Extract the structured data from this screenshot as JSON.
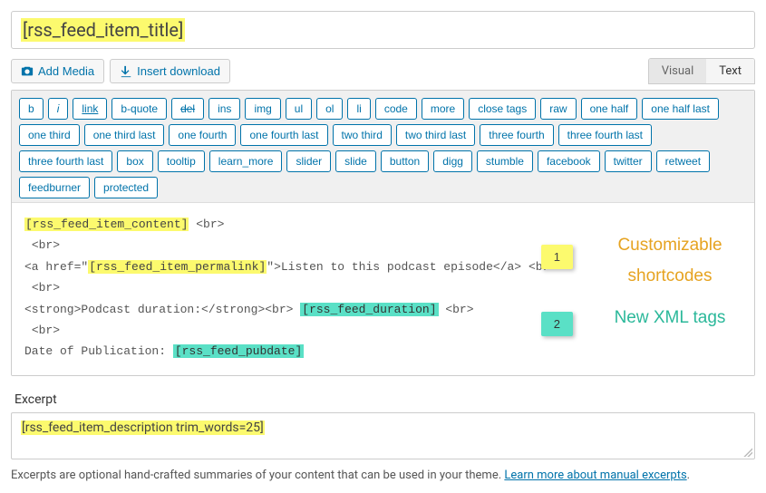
{
  "title_shortcode": "[rss_feed_item_title]",
  "buttons": {
    "add_media": "Add Media",
    "insert_download": "Insert download"
  },
  "tabs": {
    "visual": "Visual",
    "text": "Text"
  },
  "quicktags": [
    "b",
    "i",
    "link",
    "b-quote",
    "del",
    "ins",
    "img",
    "ul",
    "ol",
    "li",
    "code",
    "more",
    "close tags",
    "raw",
    "one half",
    "one half last",
    "one third",
    "one third last",
    "one fourth",
    "one fourth last",
    "two third",
    "two third last",
    "three fourth",
    "three fourth last",
    "three fourth last",
    "box",
    "tooltip",
    "learn_more",
    "slider",
    "slide",
    "button",
    "digg",
    "stumble",
    "facebook",
    "twitter",
    "retweet",
    "feedburner",
    "protected"
  ],
  "content": {
    "sc_content": "[rss_feed_item_content]",
    "br": "<br>",
    "a_open_prefix": "<a href=\"",
    "sc_permalink": "[rss_feed_item_permalink]",
    "a_open_suffix": "\">Listen to this podcast episode</a>",
    "strong_open": "<strong>Podcast duration:</strong><br>",
    "sc_duration": "[rss_feed_duration]",
    "pub_label": "Date of Publication: ",
    "sc_pubdate": "[rss_feed_pubdate]"
  },
  "badges": {
    "one": "1",
    "two": "2"
  },
  "annotations": {
    "custom": "Customizable shortcodes",
    "xml": "New XML tags"
  },
  "excerpt_label": "Excerpt",
  "excerpt_value": "[rss_feed_item_description trim_words=25]",
  "helper_text": "Excerpts are optional hand-crafted summaries of your content that can be used in your theme. ",
  "helper_link": "Learn more about manual excerpts",
  "helper_period": "."
}
